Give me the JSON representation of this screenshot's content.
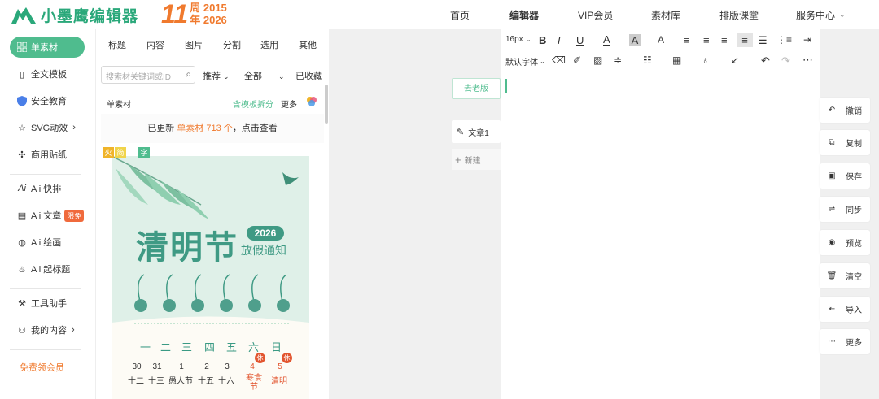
{
  "app": {
    "logo_text": "小墨鹰编辑器",
    "anniv_num": "11",
    "anniv_week": "周",
    "anniv_year": "年",
    "anniv_from": "2015",
    "anniv_to": "2026"
  },
  "nav": [
    "首页",
    "编辑器",
    "VIP会员",
    "素材库",
    "排版课堂",
    "服务中心"
  ],
  "sidebar": {
    "items": [
      {
        "label": "单素材",
        "icon": "grid-icon"
      },
      {
        "label": "全文模板",
        "icon": "template-icon"
      },
      {
        "label": "安全教育",
        "icon": "shield-icon"
      },
      {
        "label": "SVG动效",
        "icon": "star-icon"
      },
      {
        "label": "商用贴纸",
        "icon": "sticker-icon"
      },
      {
        "label": "A i 快排",
        "icon": "ai-icon"
      },
      {
        "label": "A i 文章",
        "icon": "doc-icon",
        "badge": "限免"
      },
      {
        "label": "A i 绘画",
        "icon": "palette-icon"
      },
      {
        "label": "A i 起标题",
        "icon": "fire-icon"
      },
      {
        "label": "工具助手",
        "icon": "tool-icon"
      },
      {
        "label": "我的内容",
        "icon": "user-icon"
      },
      {
        "label": "免费领会员",
        "icon": ""
      }
    ]
  },
  "panel": {
    "categories": [
      "标题",
      "内容",
      "图片",
      "分割",
      "选用",
      "其他"
    ],
    "search_placeholder": "搜索材关键词或ID",
    "filter_sort": "推荐",
    "filter_all": "全部",
    "filter_saved": "已收藏",
    "section_title": "单素材",
    "section_link": "含模板拆分",
    "section_more": "更多",
    "banner_prefix": "已更新 ",
    "banner_highlight": "单素材 713 个",
    "banner_suffix": "，点击查看",
    "card": {
      "title": "清明节",
      "year": "2026",
      "subtitle": "放假通知",
      "tags": [
        "火",
        "简",
        "字"
      ],
      "weekdays": [
        "一",
        "二",
        "三",
        "四",
        "五",
        "六",
        "日"
      ],
      "dates": [
        "30",
        "31",
        "1",
        "2",
        "3",
        "4",
        "5"
      ],
      "date_labels": [
        "十二",
        "十三",
        "愚人节",
        "十五",
        "十六",
        "寒食节",
        "清明"
      ],
      "rest": "休"
    }
  },
  "tabs": {
    "old_version": "去老版",
    "doc1": "文章1",
    "new": "新建"
  },
  "toolbar": {
    "font_size": "16px",
    "font_family": "默认字体"
  },
  "right_actions": [
    "撤销",
    "复制",
    "保存",
    "同步",
    "预览",
    "清空",
    "导入",
    "更多"
  ],
  "colors": {
    "brand": "#4fbc8e",
    "logo": "#2aa87a",
    "accent": "#f07a2e"
  }
}
